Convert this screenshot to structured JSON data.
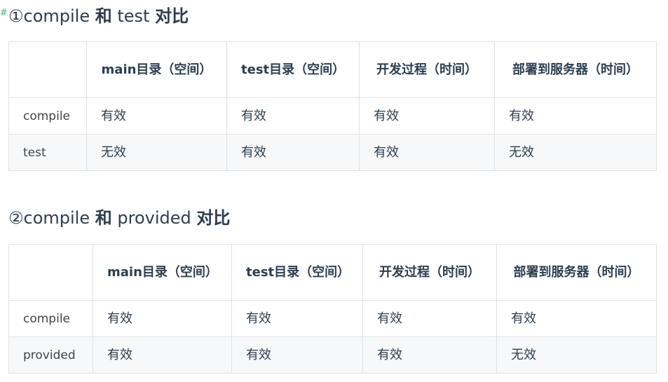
{
  "section1": {
    "anchor": "#",
    "title_prefix": "①compile ",
    "title_and": "和",
    "title_mid": " test ",
    "title_suffix": "对比",
    "headers": [
      "",
      "main目录（空间）",
      "test目录（空间）",
      "开发过程（时间）",
      "部署到服务器（时间）"
    ],
    "rows": [
      [
        "compile",
        "有效",
        "有效",
        "有效",
        "有效"
      ],
      [
        "test",
        "无效",
        "有效",
        "有效",
        "无效"
      ]
    ]
  },
  "section2": {
    "title_prefix": "②compile ",
    "title_and": "和",
    "title_mid": " provided ",
    "title_suffix": "对比",
    "headers": [
      "",
      "main目录（空间）",
      "test目录（空间）",
      "开发过程（时间）",
      "部署到服务器（时间）"
    ],
    "rows": [
      [
        "compile",
        "有效",
        "有效",
        "有效",
        "有效"
      ],
      [
        "provided",
        "有效",
        "有效",
        "有效",
        "无效"
      ]
    ]
  },
  "colors": {
    "text": "#2c3e50",
    "border": "#dfe2e5",
    "stripe": "#f6f8fa",
    "anchor": "#42b983"
  }
}
